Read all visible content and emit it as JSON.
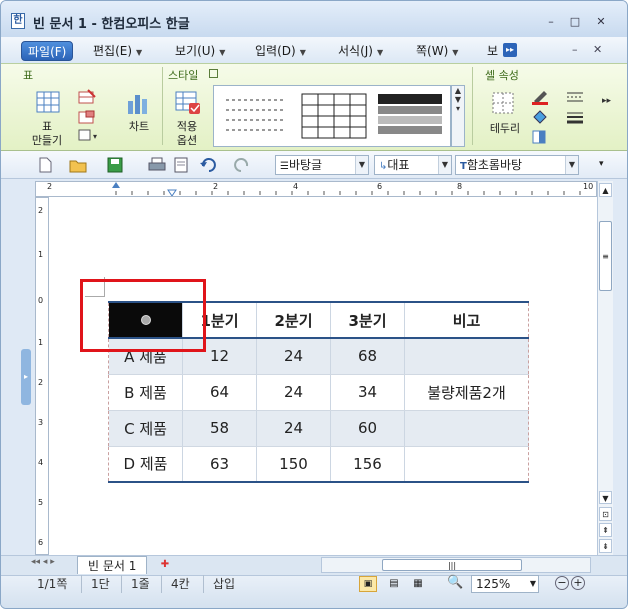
{
  "window": {
    "title": "빈 문서 1 - 한컴오피스 한글",
    "app_icon": "hwp-app-icon",
    "controls": {
      "minimize": "–",
      "maximize": "□",
      "close": "✕"
    }
  },
  "menu": {
    "items": [
      {
        "label": "파일(F)",
        "active": true
      },
      {
        "label": "편집(E)"
      },
      {
        "label": "보기(U)"
      },
      {
        "label": "입력(D)"
      },
      {
        "label": "서식(J)"
      },
      {
        "label": "쪽(W)"
      },
      {
        "label": "보"
      }
    ],
    "overflow": "▸▸",
    "right_icons": [
      "–",
      "✕"
    ]
  },
  "ribbon": {
    "group_table": "표",
    "make_table": "표\n만들기",
    "chart": "차트",
    "group_style": "스타일",
    "apply_options": "적용\n옵션",
    "group_cell": "셀 속성",
    "border": "테두리"
  },
  "toolbar": {
    "style_combo": "바탕글",
    "font_lang_combo": "대표",
    "font_combo": "함초롬바탕"
  },
  "ruler": {
    "h_ticks": [
      "2",
      "2",
      "4",
      "6",
      "8",
      "10"
    ],
    "v_ticks": [
      "2",
      "1",
      "0",
      "1",
      "2",
      "3",
      "4",
      "5",
      "6"
    ]
  },
  "table": {
    "headers": [
      "",
      "1분기",
      "2분기",
      "3분기",
      "비고"
    ],
    "rows": [
      [
        "A 제품",
        "12",
        "24",
        "68",
        ""
      ],
      [
        "B 제품",
        "64",
        "24",
        "34",
        "불량제품2개"
      ],
      [
        "C 제품",
        "58",
        "24",
        "60",
        ""
      ],
      [
        "D 제품",
        "63",
        "150",
        "156",
        ""
      ]
    ]
  },
  "tabs": {
    "doc_tab": "빈 문서 1"
  },
  "status": {
    "page": "1/1쪽",
    "section": "1단",
    "line": "1줄",
    "col": "4칸",
    "mode": "삽입",
    "zoom": "125%"
  },
  "colors": {
    "selection_red": "#e0141a",
    "table_border": "#2b5287",
    "shaded_row": "#e5ebf2"
  }
}
